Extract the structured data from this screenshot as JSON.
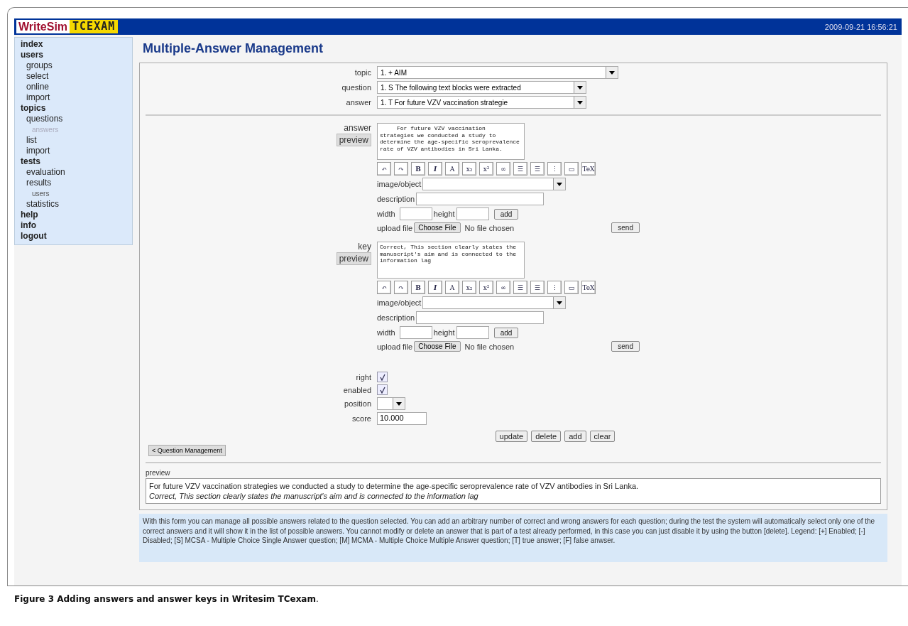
{
  "header": {
    "logo_main": "WriteSim",
    "logo_badge": "TCEXAM",
    "timestamp": "2009-09-21 16:56:21"
  },
  "sidebar": {
    "items": [
      {
        "label": "index",
        "selected": false
      },
      {
        "label": "users",
        "selected": false,
        "children": [
          {
            "label": "groups",
            "selected": false
          },
          {
            "label": "select",
            "selected": false
          },
          {
            "label": "online",
            "selected": false
          },
          {
            "label": "import",
            "selected": false
          }
        ]
      },
      {
        "label": "topics",
        "selected": false,
        "children": [
          {
            "label": "questions",
            "selected": false,
            "children": [
              {
                "label": "answers",
                "selected": true
              }
            ]
          },
          {
            "label": "list",
            "selected": false
          },
          {
            "label": "import",
            "selected": false
          }
        ]
      },
      {
        "label": "tests",
        "selected": false,
        "children": [
          {
            "label": "evaluation",
            "selected": false
          },
          {
            "label": "results",
            "selected": false,
            "children": [
              {
                "label": "users",
                "selected": false
              }
            ]
          },
          {
            "label": "statistics",
            "selected": false
          }
        ]
      },
      {
        "label": "help",
        "selected": false
      },
      {
        "label": "info",
        "selected": false
      },
      {
        "label": "logout",
        "selected": false
      }
    ]
  },
  "page_title": "Multiple-Answer Management",
  "selectors": [
    {
      "label": "topic",
      "value": "1. + AIM"
    },
    {
      "label": "question",
      "value": "1. S The following text blocks were extracted"
    },
    {
      "label": "answer",
      "value": "1. T For future VZV vaccination strategie"
    }
  ],
  "editors": [
    {
      "label": "answer",
      "preview_button": "preview",
      "text": "     For future VZV vaccination strategies we conducted a study to determine the age-specific seroprevalence rate of VZV antibodies in Sri Lanka.",
      "toolbar": [
        "↶",
        "↷",
        "B",
        "I",
        "A",
        "x₂",
        "x²",
        "∞",
        "☰",
        "☰",
        "⋮",
        "▭",
        "TeX"
      ],
      "image_label": "image/object",
      "description_label": "description",
      "width_label": "width",
      "height_label": "height",
      "add_button": "add",
      "upload_label": "upload file",
      "choose_button": "Choose File",
      "file_status": "No file chosen",
      "send_button": "send"
    },
    {
      "label": "key",
      "preview_button": "preview",
      "text": "Correct, This section clearly states the manuscript's aim and is connected to the information lag",
      "toolbar": [
        "↶",
        "↷",
        "B",
        "I",
        "A",
        "x₂",
        "x²",
        "∞",
        "☰",
        "☰",
        "⋮",
        "▭",
        "TeX"
      ],
      "image_label": "image/object",
      "description_label": "description",
      "width_label": "width",
      "height_label": "height",
      "add_button": "add",
      "upload_label": "upload file",
      "choose_button": "Choose File",
      "file_status": "No file chosen",
      "send_button": "send"
    }
  ],
  "options": [
    {
      "label": "right",
      "checked": true
    },
    {
      "label": "enabled",
      "checked": true
    }
  ],
  "position": {
    "label": "position"
  },
  "score": {
    "label": "score",
    "value": "10.000"
  },
  "actions": [
    "update",
    "delete",
    "add",
    "clear"
  ],
  "back_button": "< Question Management",
  "preview": {
    "label": "preview",
    "answer": "For future VZV vaccination strategies we conducted a study to determine the age-specific seroprevalence rate of VZV antibodies in Sri Lanka.",
    "key": "Correct, This section clearly states the manuscript's aim and is connected to the information lag"
  },
  "help_text": "With this form you can manage all possible answers related to the question selected. You can add an arbitrary number of correct and wrong answers for each question; during the test the system will automatically select only one of the correct answers and it will show it in the list of possible answers. You cannot modify or delete an answer that is part of a test already performed, in this case you can just disable it by using the button [delete]. Legend: [+] Enabled; [-] Disabled; [S] MCSA - Multiple Choice Single Answer question; [M] MCMA - Multiple Choice Multiple Answer question; [T] true answer; [F] false anwser.",
  "caption": "**Figure 3 Adding answers and answer keys in Writesim TCexam**."
}
